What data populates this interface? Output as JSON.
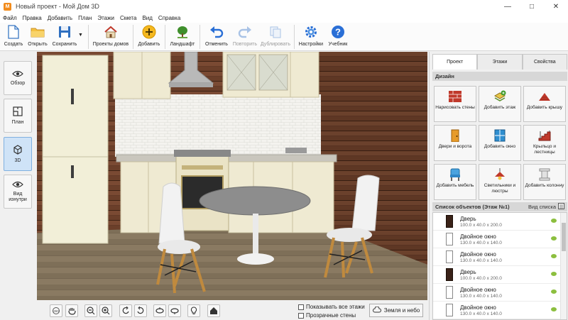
{
  "window": {
    "title": "Новый проект - Мой Дом 3D",
    "app_icon": "app-logo-icon",
    "controls": [
      "minimize-icon",
      "maximize-icon",
      "close-icon"
    ]
  },
  "menu": [
    "Файл",
    "Правка",
    "Добавить",
    "План",
    "Этажи",
    "Смета",
    "Вид",
    "Справка"
  ],
  "toolbar": {
    "create": "Создать",
    "open": "Открыть",
    "save": "Сохранить",
    "house_projects": "Проекты домов",
    "add": "Добавить",
    "landscape": "Ландшафт",
    "undo": "Отменить",
    "redo": "Повторить",
    "duplicate": "Дублировать",
    "settings": "Настройки",
    "tutorial": "Учебник"
  },
  "leftnav": {
    "overview": "Обзор",
    "plan": "План",
    "view3d": "3D",
    "inside": "Вид изнутри",
    "active": "3D"
  },
  "bottombar": {
    "show_all_floors": "Показывать все этажи",
    "transparent_walls": "Прозрачные стены",
    "earth_sky": "Земля и небо"
  },
  "rightpanel": {
    "tabs": [
      "Проект",
      "Этажи",
      "Свойства"
    ],
    "active_tab": "Проект",
    "design_header": "Дизайн",
    "design_items": [
      {
        "label": "Нарисовать стены",
        "icon": "brick-wall-icon"
      },
      {
        "label": "Добавить этаж",
        "icon": "add-floor-icon"
      },
      {
        "label": "Добавить крышу",
        "icon": "roof-icon"
      },
      {
        "label": "Двери и ворота",
        "icon": "door-icon"
      },
      {
        "label": "Добавить окно",
        "icon": "window-icon"
      },
      {
        "label": "Крыльцо и лестницы",
        "icon": "stairs-icon"
      },
      {
        "label": "Добавить мебель",
        "icon": "chair-icon"
      },
      {
        "label": "Светильники и люстры",
        "icon": "lamp-icon"
      },
      {
        "label": "Добавить колонну",
        "icon": "column-icon"
      }
    ],
    "objects_header": "Список объектов (Этаж №1)",
    "objects_view": "Вид списка",
    "objects": [
      {
        "name": "Дверь",
        "dims": "100.0 x 40.0 x 200.0",
        "kind": "door"
      },
      {
        "name": "Двойное окно",
        "dims": "130.0 x 40.0 x 140.0",
        "kind": "window"
      },
      {
        "name": "Двойное окно",
        "dims": "130.0 x 40.0 x 140.0",
        "kind": "window"
      },
      {
        "name": "Дверь",
        "dims": "100.0 x 40.0 x 200.0",
        "kind": "door"
      },
      {
        "name": "Двойное окно",
        "dims": "130.0 x 40.0 x 140.0",
        "kind": "window"
      },
      {
        "name": "Двойное окно",
        "dims": "130.0 x 40.0 x 140.0",
        "kind": "window"
      }
    ]
  },
  "colors": {
    "accent": "#2a6fd6",
    "active_nav": "#cfe3f7",
    "section_header": "#d7d7d7",
    "visible_indicator": "#8cbf3f"
  }
}
